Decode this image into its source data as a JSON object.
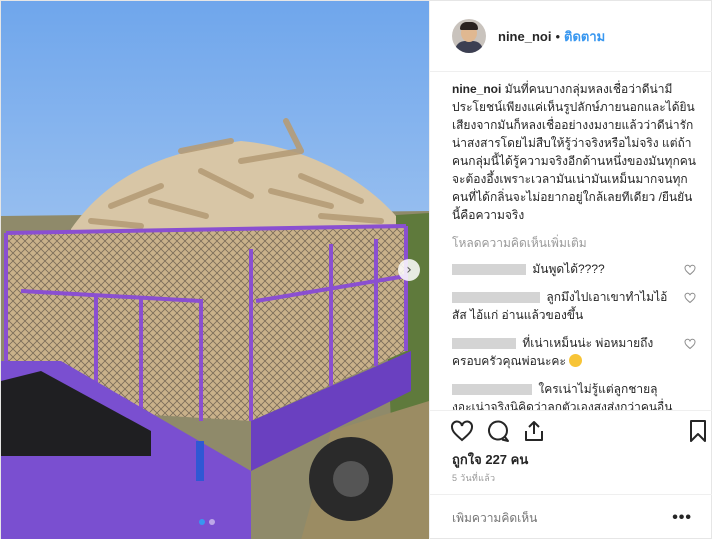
{
  "post": {
    "username": "nine_noi",
    "separator": "•",
    "follow_label": "ติดตาม"
  },
  "caption": {
    "username": "nine_noi",
    "text": "มันที่คนบางกลุ่มหลงเชื่อว่าดีน่ามีประโยชน์เพียงแค่เห็นรูปลักษ์ภายนอกและได้ยินเสียงจากมันก็หลงเชื่ออย่างงมงายแล้วว่าดีน่ารักน่าสงสารโดยไม่สืบให้รู้ว่าจริงหรือไม่จริง แต่ถ้าคนกลุ่มนี้ได้รู้ความจริงอีกด้านหนึ่งของมันทุกคนจะต้องอึ้งเพราะเวลามันเน่ามันเหม็นมากจนทุกคนที่ได้กลิ่นจะไม่อยากอยู่ใกล้เลยทีเดียว /ยืนยันนี้คือความจริง"
  },
  "load_more_label": "โหลดความคิดเห็นเพิ่มเติม",
  "comments": [
    {
      "text": "มันพูดได้????"
    },
    {
      "text": "ลูกมึงไปเอาเขาทำไมไอ้สัส ไอ้แก่ อ่านแล้วของขึ้น"
    },
    {
      "text": "ที่เน่าเหม็นน่ะ พ่อหมายถึงครอบครัวคุณพ่อนะคะ"
    },
    {
      "text": "ใครเน่าไม่รู้แต่ลูกชายลุงอะเน่าจริงนิคิดว่าลูกตัวเองสูงส่งกว่าคนอื่นหรอทั้งเน่าทั้งเหม็นเลยอย่าลืมสอนลูกให้เป็นลูกผู้ชายมั่งนะเกลียดทั้งโคตรเลย"
    }
  ],
  "likes": {
    "label": "ถูกใจ",
    "count": "227",
    "unit": "คน"
  },
  "time_ago": "5 วันที่แล้ว",
  "add_comment": {
    "placeholder": "เพิ่มความคิดเห็น"
  },
  "more_label": "•••",
  "icons": {
    "heart": "heart-icon",
    "comment": "comment-icon",
    "share": "share-icon",
    "save": "bookmark-icon",
    "next": "chevron-right-icon"
  },
  "colors": {
    "accent": "#3897f0",
    "cart": "#7a4fd0"
  }
}
